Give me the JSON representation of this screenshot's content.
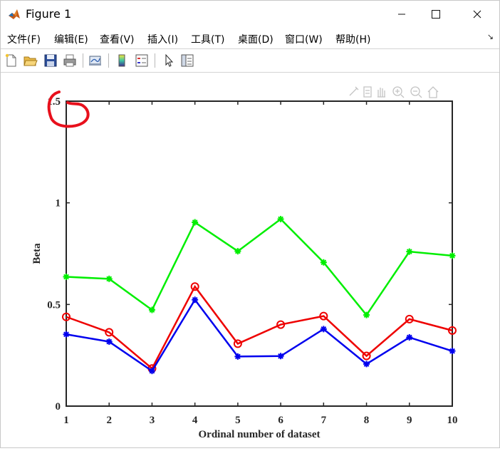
{
  "window": {
    "title": "Figure 1",
    "controls": {
      "minimize": "—",
      "maximize": "☐",
      "close": "✕"
    }
  },
  "menubar": {
    "items": [
      {
        "label": "文件(F)"
      },
      {
        "label": "编辑(E)"
      },
      {
        "label": "查看(V)"
      },
      {
        "label": "插入(I)"
      },
      {
        "label": "工具(T)"
      },
      {
        "label": "桌面(D)"
      },
      {
        "label": "窗口(W)"
      },
      {
        "label": "帮助(H)"
      }
    ],
    "dock_arrow": "↘"
  },
  "toolbar": {
    "icons": [
      "new-figure-icon",
      "open-file-icon",
      "save-icon",
      "print-icon",
      "link-plot-icon",
      "colorbar-icon",
      "legend-icon",
      "pointer-icon",
      "property-inspector-icon"
    ]
  },
  "axes_toolbar": {
    "icons": [
      "brush-icon",
      "data-tips-icon",
      "pan-icon",
      "zoom-in-icon",
      "zoom-out-icon",
      "home-icon"
    ]
  },
  "colors": {
    "green": "#00ee00",
    "red": "#ee0000",
    "blue": "#0000ee",
    "annotation": "#e8101c"
  },
  "chart_data": {
    "type": "line",
    "xlabel": "Ordinal number of dataset",
    "ylabel": "Beta",
    "xlim": [
      1,
      10
    ],
    "ylim": [
      0,
      1.5
    ],
    "x": [
      1,
      2,
      3,
      4,
      5,
      6,
      7,
      8,
      9,
      10
    ],
    "xticks": [
      "1",
      "2",
      "3",
      "4",
      "5",
      "6",
      "7",
      "8",
      "9",
      "10"
    ],
    "yticks": [
      "0",
      "0.5",
      "1",
      "1.5"
    ],
    "ytick_values": [
      0,
      0.5,
      1,
      1.5
    ],
    "grid": false,
    "series": [
      {
        "color": "#00ee00",
        "marker": "asterisk",
        "values": [
          0.636,
          0.626,
          0.473,
          0.904,
          0.762,
          0.92,
          0.707,
          0.448,
          0.76,
          0.74
        ]
      },
      {
        "color": "#ee0000",
        "marker": "circle",
        "values": [
          0.439,
          0.363,
          0.185,
          0.588,
          0.307,
          0.401,
          0.443,
          0.247,
          0.428,
          0.372
        ]
      },
      {
        "color": "#0000ee",
        "marker": "asterisk",
        "values": [
          0.353,
          0.317,
          0.173,
          0.523,
          0.244,
          0.246,
          0.379,
          0.207,
          0.338,
          0.271
        ]
      }
    ]
  }
}
